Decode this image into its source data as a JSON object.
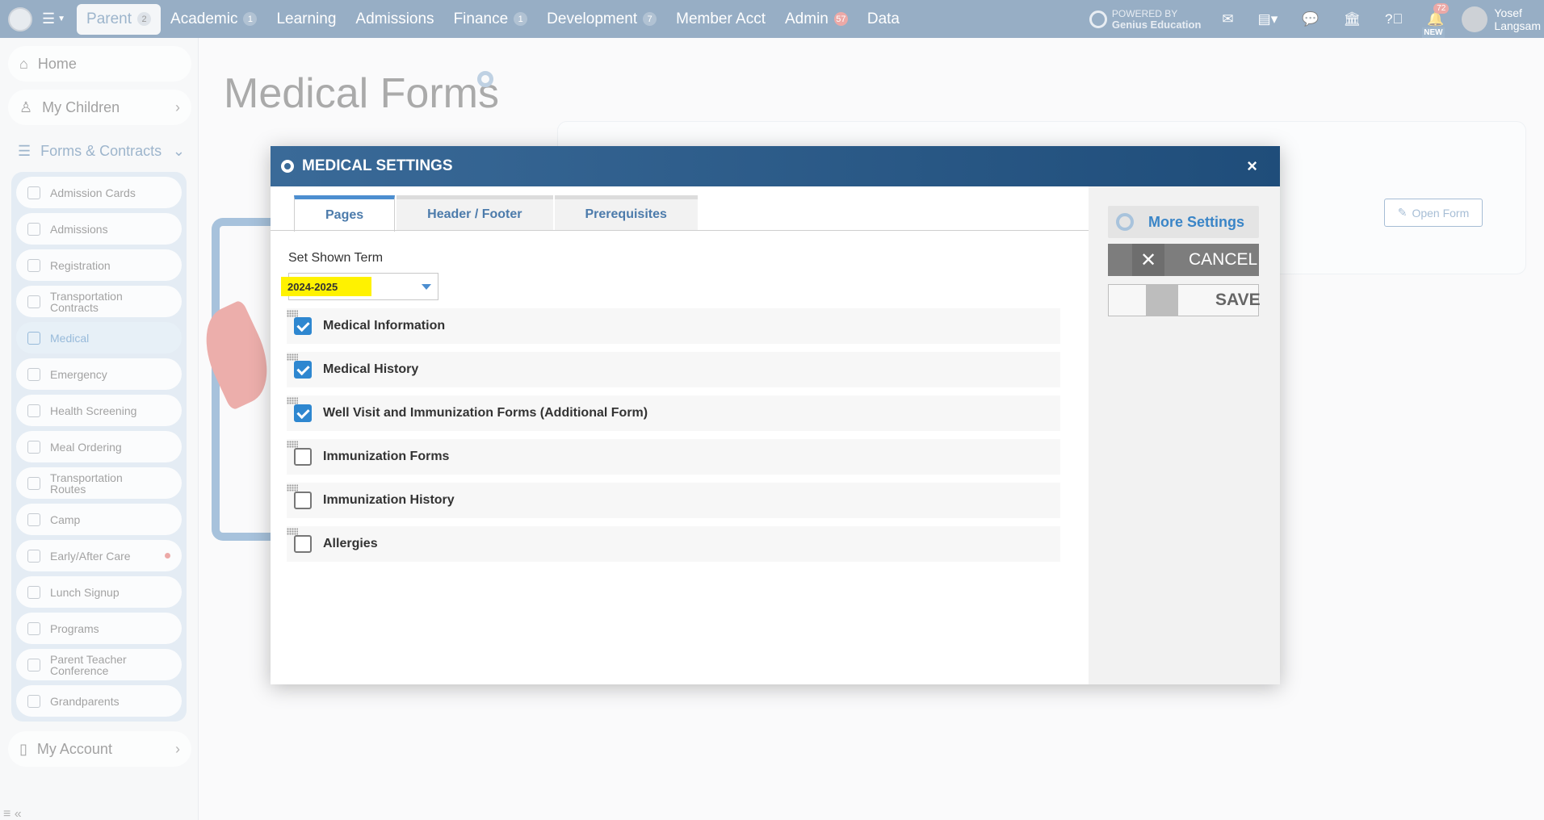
{
  "nav": {
    "items": [
      {
        "label": "Parent",
        "badge": "2",
        "active": true
      },
      {
        "label": "Academic",
        "badge": "1"
      },
      {
        "label": "Learning",
        "badge": ""
      },
      {
        "label": "Admissions",
        "badge": ""
      },
      {
        "label": "Finance",
        "badge": "1"
      },
      {
        "label": "Development",
        "badge": "7"
      },
      {
        "label": "Member Acct",
        "badge": ""
      },
      {
        "label": "Admin",
        "badge": "57",
        "red": true
      },
      {
        "label": "Data",
        "badge": ""
      }
    ],
    "powered_line1": "POWERED BY",
    "powered_line2": "Genius Education",
    "notification_count": "72",
    "new_tag": "NEW",
    "user_first": "Yosef",
    "user_last": "Langsam"
  },
  "sidebar": {
    "home": "Home",
    "my_children": "My Children",
    "forms_contracts": "Forms & Contracts",
    "items": [
      {
        "label": "Admission Cards"
      },
      {
        "label": "Admissions"
      },
      {
        "label": "Registration"
      },
      {
        "label": "Transportation Contracts"
      },
      {
        "label": "Medical",
        "active": true
      },
      {
        "label": "Emergency"
      },
      {
        "label": "Health Screening"
      },
      {
        "label": "Meal Ordering"
      },
      {
        "label": "Transportation Routes"
      },
      {
        "label": "Camp"
      },
      {
        "label": "Early/After Care",
        "dot": true
      },
      {
        "label": "Lunch Signup"
      },
      {
        "label": "Programs"
      },
      {
        "label": "Parent Teacher Conference"
      },
      {
        "label": "Grandparents"
      }
    ],
    "my_account": "My Account"
  },
  "page": {
    "title": "Medical Forms",
    "open_form": "Open Form"
  },
  "modal": {
    "title": "MEDICAL SETTINGS",
    "close": "×",
    "tabs": [
      {
        "label": "Pages",
        "active": true
      },
      {
        "label": "Header / Footer"
      },
      {
        "label": "Prerequisites"
      }
    ],
    "term_label": "Set Shown Term",
    "term_value": "2024-2025",
    "rows": [
      {
        "label": "Medical Information",
        "checked": true
      },
      {
        "label": "Medical History",
        "checked": true
      },
      {
        "label": "Well Visit and Immunization Forms (Additional Form)",
        "checked": true
      },
      {
        "label": "Immunization Forms",
        "checked": false
      },
      {
        "label": "Immunization History",
        "checked": false
      },
      {
        "label": "Allergies",
        "checked": false
      }
    ],
    "more_settings": "More Settings",
    "cancel": "CANCEL",
    "save": "SAVE"
  },
  "colors": {
    "nav_bg": "#2e5c8a",
    "accent": "#2e87d0",
    "highlight": "#fff200"
  }
}
